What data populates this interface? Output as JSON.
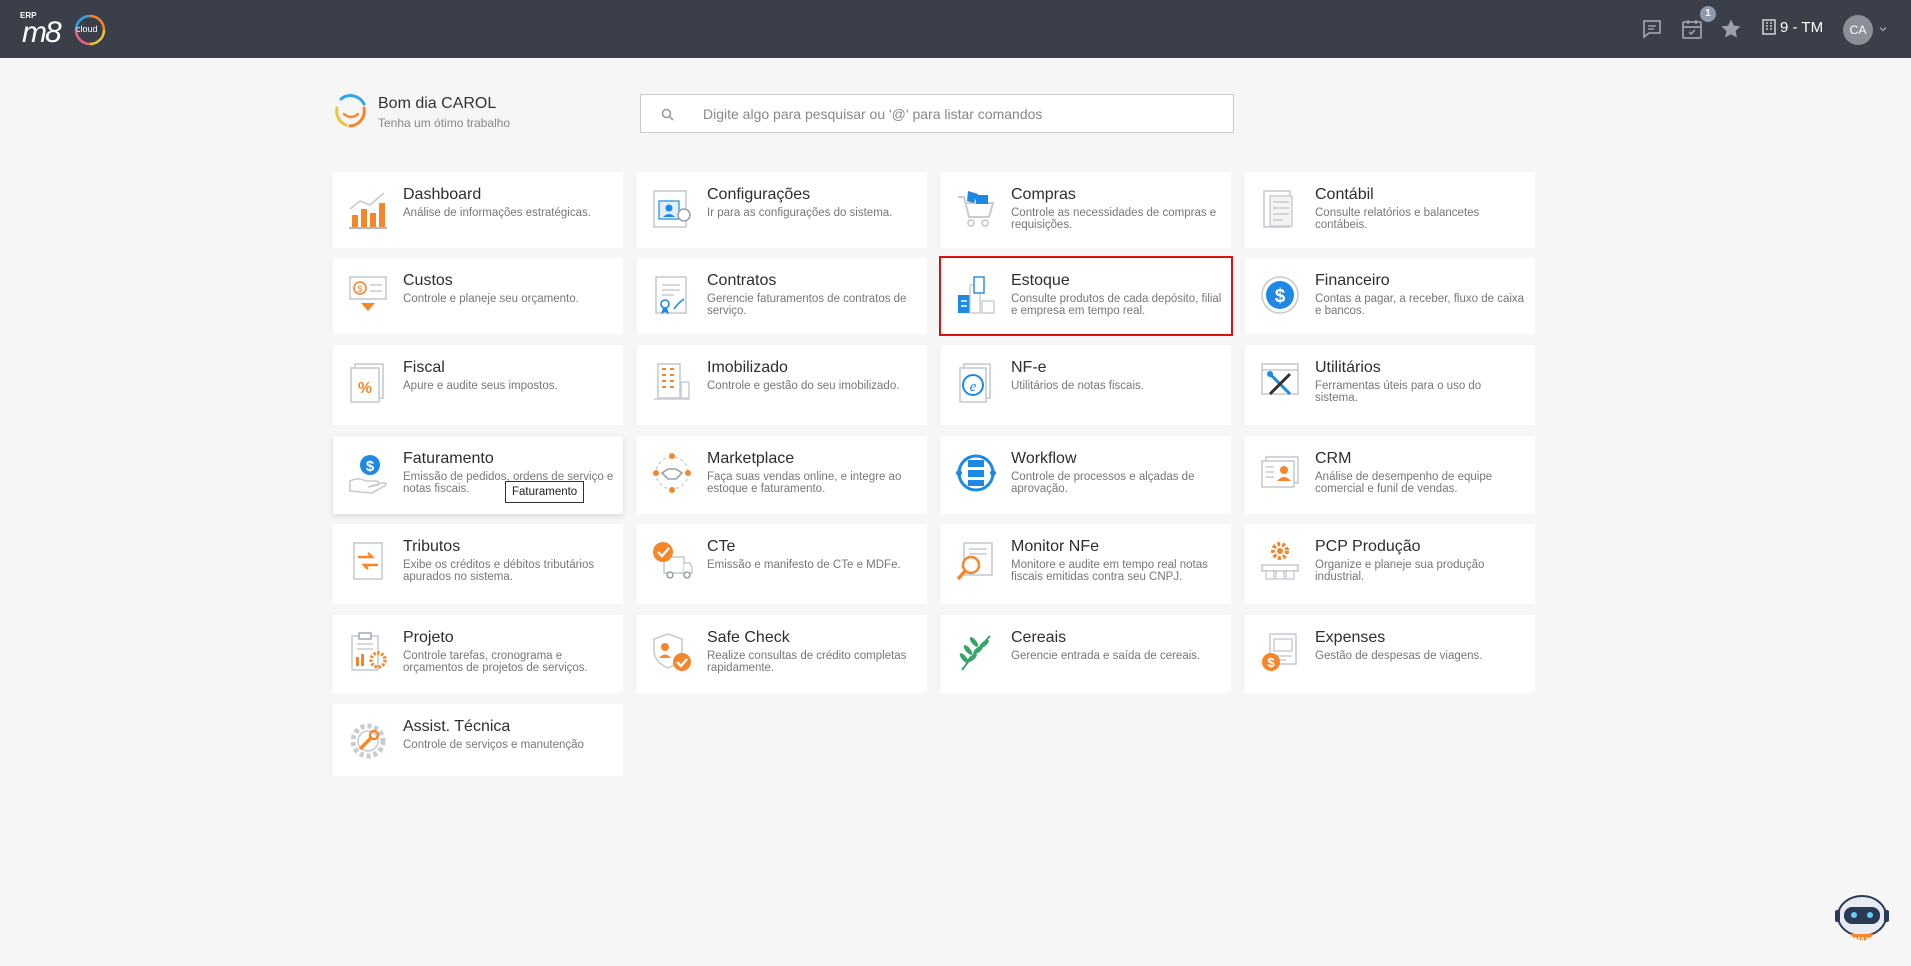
{
  "header": {
    "logo_erp": "ERP",
    "logo_main": "m8",
    "logo_cloud": "cloud",
    "notification_count": "1",
    "company": "9 - TM",
    "user_initials": "CA",
    "icons": [
      "chat-icon",
      "calendar-icon",
      "star-icon",
      "building-icon",
      "chevron-down-icon"
    ]
  },
  "greeting": {
    "title": "Bom dia CAROL",
    "subtitle": "Tenha um ótimo trabalho"
  },
  "search": {
    "placeholder": "Digite algo para pesquisar ou '@' para listar comandos"
  },
  "modules": [
    {
      "title": "Dashboard",
      "desc": "Análise de informações estratégicas.",
      "icon": "chart-icon"
    },
    {
      "title": "Configurações",
      "desc": "Ir para as configurações do sistema.",
      "icon": "settings-profile-icon"
    },
    {
      "title": "Compras",
      "desc": "Controle as necessidades de compras e requisições.",
      "icon": "cart-icon"
    },
    {
      "title": "Contábil",
      "desc": "Consulte relatórios e balancetes contábeis.",
      "icon": "calculator-icon"
    },
    {
      "title": "Custos",
      "desc": "Controle e planeje seu orçamento.",
      "icon": "cost-icon"
    },
    {
      "title": "Contratos",
      "desc": "Gerencie faturamentos de contratos de serviço.",
      "icon": "contract-icon"
    },
    {
      "title": "Estoque",
      "desc": "Consulte produtos de cada depósito, filial e empresa em tempo real.",
      "icon": "warehouse-icon"
    },
    {
      "title": "Financeiro",
      "desc": "Contas a pagar, a receber, fluxo de caixa e bancos.",
      "icon": "dollar-circle-icon"
    },
    {
      "title": "Fiscal",
      "desc": "Apure e audite seus impostos.",
      "icon": "percent-document-icon"
    },
    {
      "title": "Imobilizado",
      "desc": "Controle e gestão do seu imobilizado.",
      "icon": "building-assets-icon"
    },
    {
      "title": "NF-e",
      "desc": "Utilitários de notas fiscais.",
      "icon": "e-document-icon"
    },
    {
      "title": "Utilitários",
      "desc": "Ferramentas úteis para o uso do sistema.",
      "icon": "tools-icon"
    },
    {
      "title": "Faturamento",
      "desc": "Emissão de pedidos, ordens de serviço e notas fiscais.",
      "icon": "billing-hand-icon"
    },
    {
      "title": "Marketplace",
      "desc": "Faça suas vendas online, e integre ao estoque e faturamento.",
      "icon": "handshake-icon"
    },
    {
      "title": "Workflow",
      "desc": "Controle de processos e alçadas de aprovação.",
      "icon": "workflow-icon"
    },
    {
      "title": "CRM",
      "desc": "Análise de desempenho de equipe comercial e funil de vendas.",
      "icon": "crm-card-icon"
    },
    {
      "title": "Tributos",
      "desc": "Exibe os créditos e débitos tributários apurados no sistema.",
      "icon": "tax-arrows-icon"
    },
    {
      "title": "CTe",
      "desc": "Emissão e manifesto de CTe e MDFe.",
      "icon": "truck-check-icon"
    },
    {
      "title": "Monitor NFe",
      "desc": "Monitore e audite em tempo real notas fiscais emitidas contra seu CNPJ.",
      "icon": "magnifier-document-icon"
    },
    {
      "title": "PCP Produção",
      "desc": "Organize e planeje sua produção industrial.",
      "icon": "production-gear-icon"
    },
    {
      "title": "Projeto",
      "desc": "Controle tarefas, cronograma e orçamentos de projetos de serviços.",
      "icon": "project-clipboard-icon"
    },
    {
      "title": "Safe Check",
      "desc": "Realize consultas de crédito completas rapidamente.",
      "icon": "shield-check-icon"
    },
    {
      "title": "Cereais",
      "desc": "Gerencie entrada e saída de cereais.",
      "icon": "wheat-icon"
    },
    {
      "title": "Expenses",
      "desc": "Gestão de despesas de viagens.",
      "icon": "expenses-icon"
    },
    {
      "title": "Assist. Técnica",
      "desc": "Controle de serviços e manutenção",
      "icon": "wrench-gear-icon"
    }
  ],
  "tooltip": "Faturamento",
  "assistant": {
    "label": "MAX"
  },
  "colors": {
    "accent_orange": "#f5862a",
    "accent_blue": "#1e88e5",
    "topbar": "#3b3f4a",
    "highlight": "#e01010"
  }
}
